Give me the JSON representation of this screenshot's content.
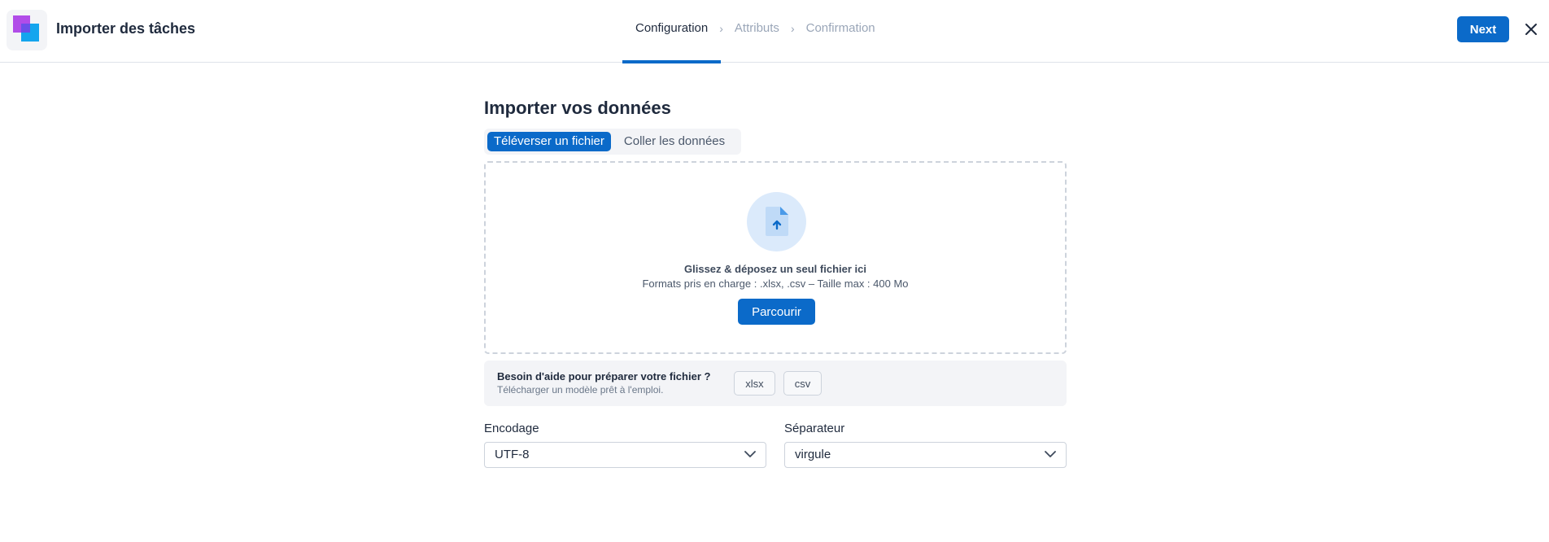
{
  "header": {
    "app_title": "Importer des tâches",
    "steps": [
      {
        "label": "Configuration",
        "state": "active"
      },
      {
        "label": "Attributs",
        "state": "inactive"
      },
      {
        "label": "Confirmation",
        "state": "inactive"
      }
    ],
    "next_label": "Next",
    "close_icon": "close-icon"
  },
  "main": {
    "title": "Importer vos données",
    "tabs": [
      {
        "label": "Téléverser un fichier",
        "active": true
      },
      {
        "label": "Coller les données",
        "active": false
      }
    ],
    "dropzone": {
      "icon": "file-upload-icon",
      "title": "Glissez & déposez un seul fichier ici",
      "subtitle": "Formats pris en charge : .xlsx, .csv – Taille max : 400 Mo",
      "browse_label": "Parcourir"
    },
    "help": {
      "title": "Besoin d'aide pour préparer votre fichier ?",
      "subtitle": "Télécharger un modèle prêt à l'emploi.",
      "templates": [
        "xlsx",
        "csv"
      ]
    },
    "encoding": {
      "label": "Encodage",
      "value": "UTF-8"
    },
    "separator": {
      "label": "Séparateur",
      "value": "virgule"
    }
  },
  "colors": {
    "accent": "#0b6ac9",
    "step_inactive": "#9aa6b8",
    "text_primary": "#1f2a3d",
    "panel_bg": "#f3f4f7"
  }
}
